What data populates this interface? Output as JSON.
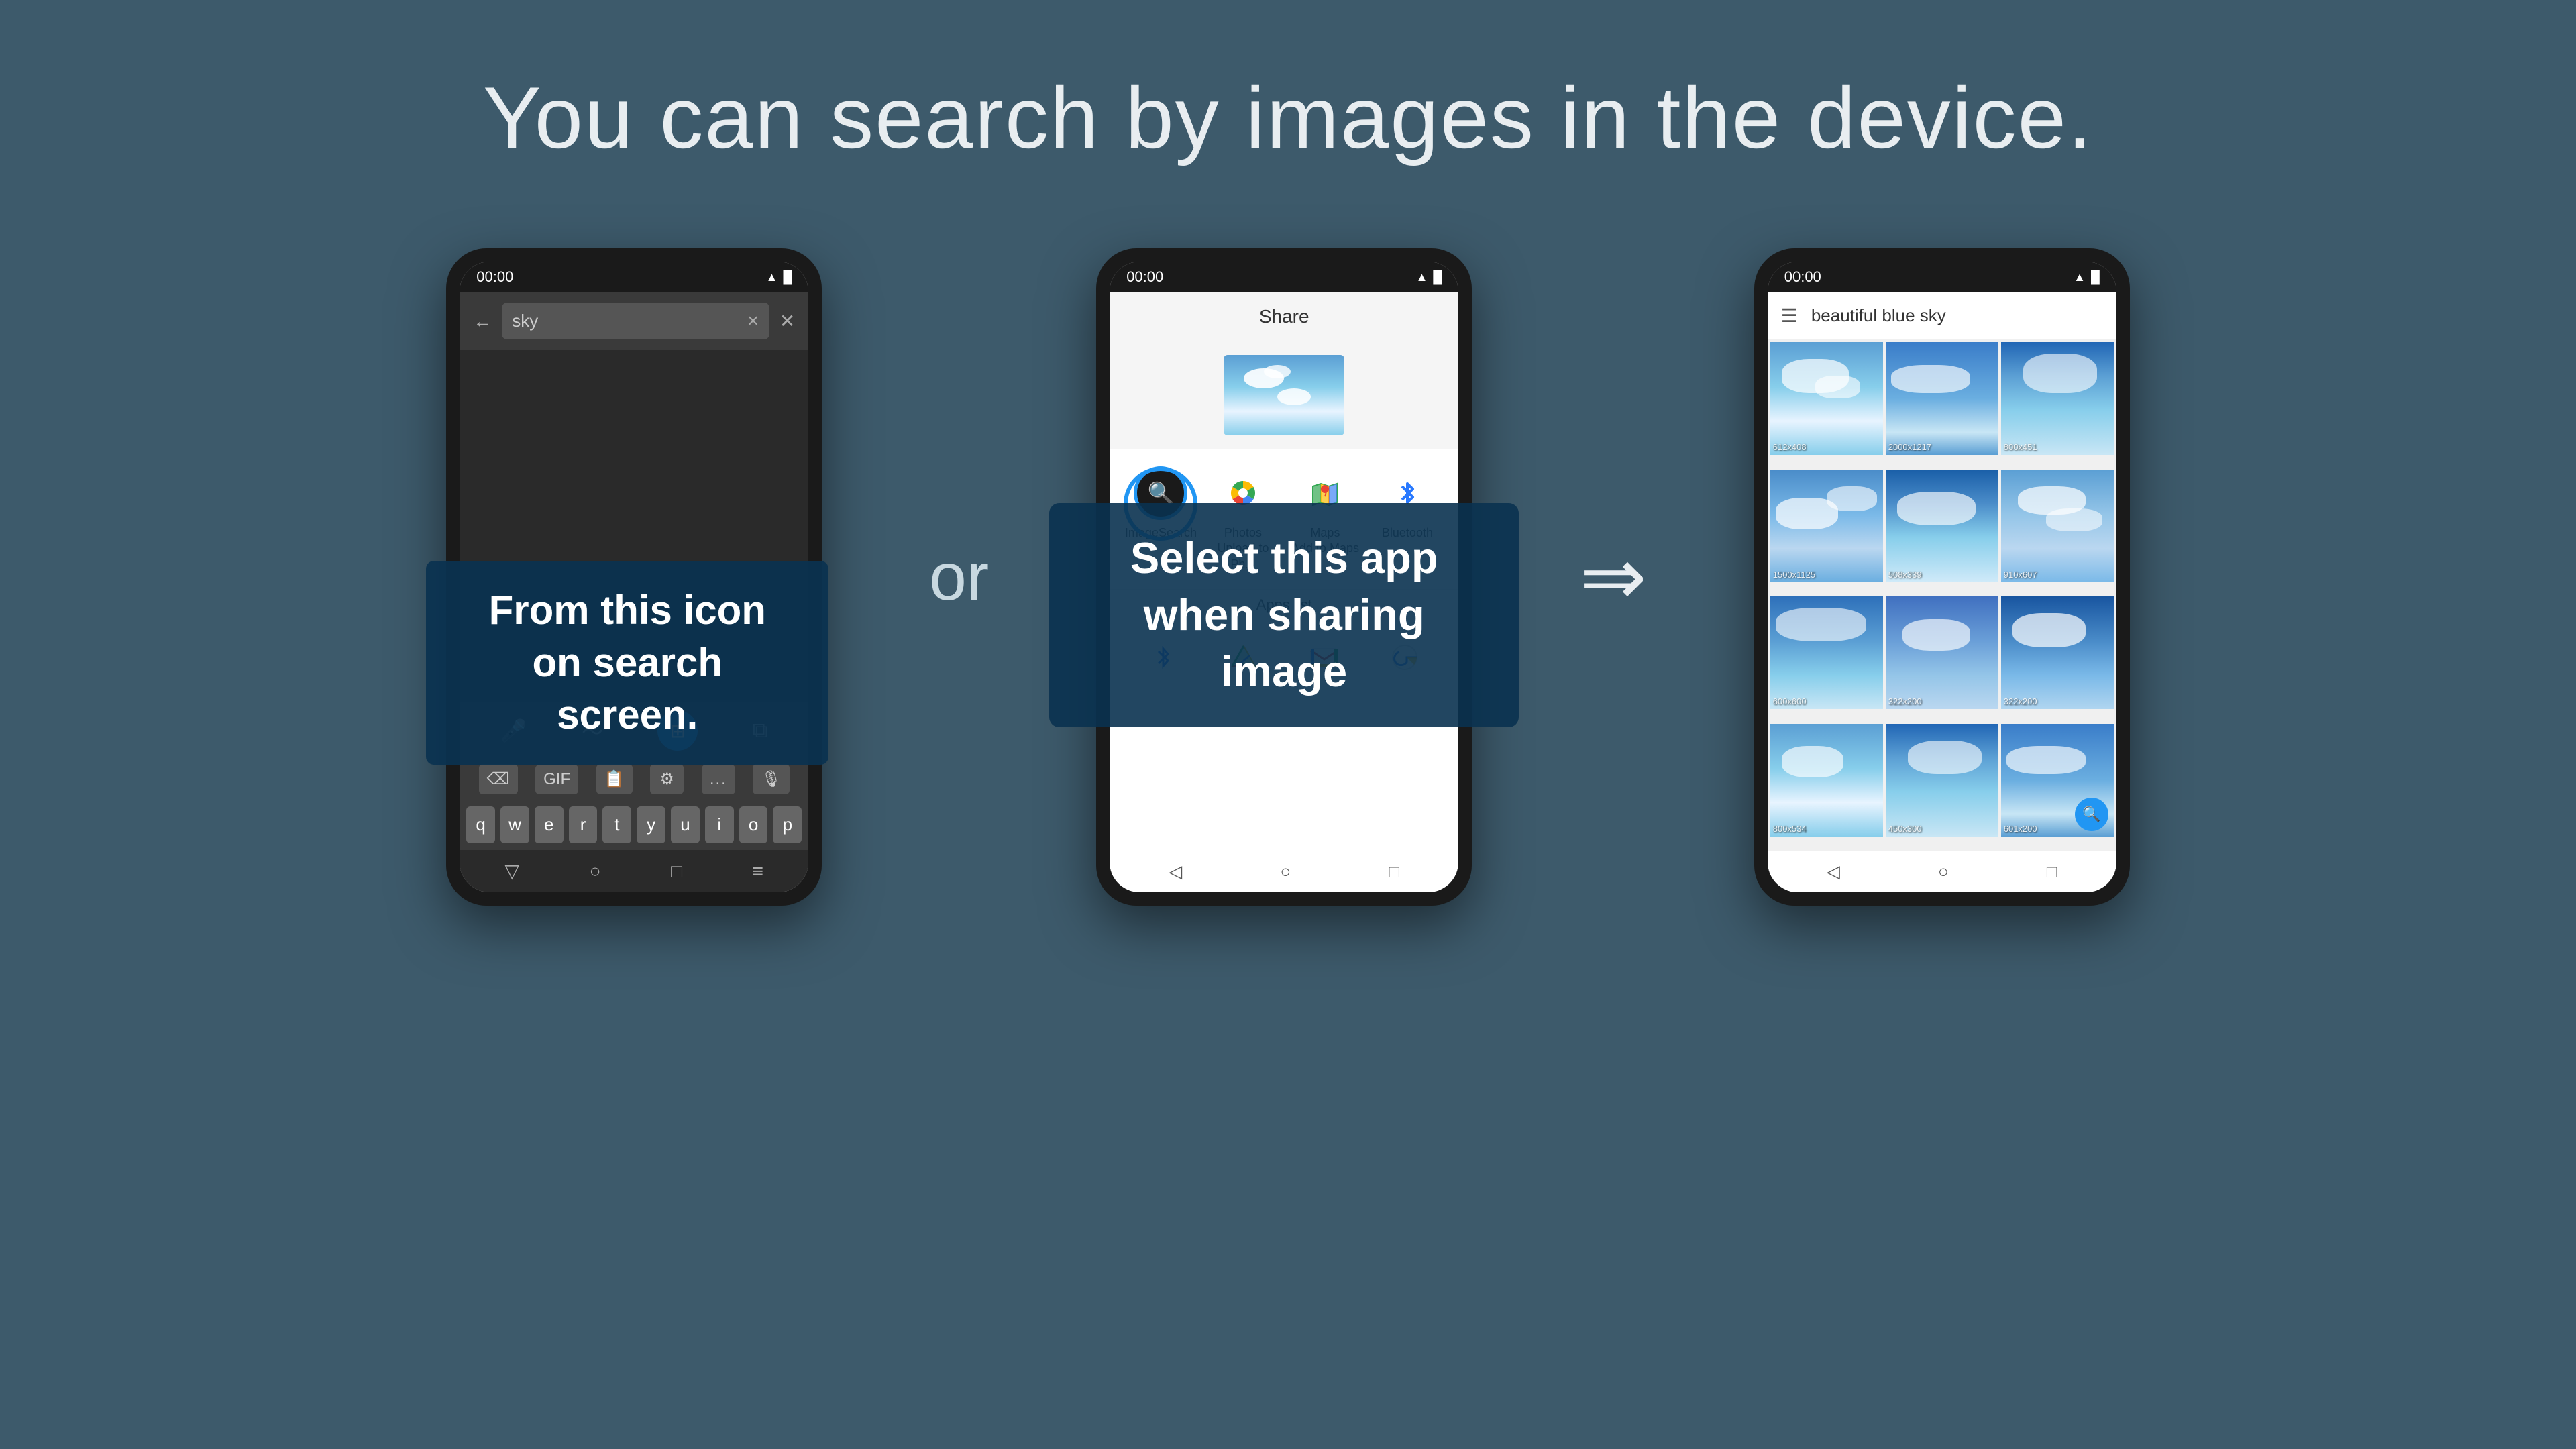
{
  "page": {
    "title": "You can search by images in the device.",
    "background_color": "#3d5a6b"
  },
  "connector": {
    "or_text": "or",
    "arrow_text": "⇒"
  },
  "tooltip_1": {
    "line1": "From this icon",
    "line2": "on search screen."
  },
  "tooltip_2": {
    "line1": "Select this app",
    "line2": "when sharing image"
  },
  "phone1": {
    "status_time": "00:00",
    "search_placeholder": "sky",
    "keyboard_keys": [
      "q",
      "w",
      "e",
      "r",
      "t",
      "y",
      "u",
      "i",
      "o",
      "p"
    ]
  },
  "phone2": {
    "status_time": "00:00",
    "share_title": "Share",
    "apps": [
      {
        "name": "ImageSearch",
        "label": "ImageSearch"
      },
      {
        "name": "Photos",
        "label": "Photos\nUpload to Ph..."
      },
      {
        "name": "Maps",
        "label": "Maps\nAdd to Maps"
      },
      {
        "name": "Bluetooth",
        "label": "Bluetooth"
      }
    ],
    "apps_list_label": "Apps list",
    "bottom_apps": [
      "bluetooth_small",
      "drive",
      "gmail",
      "google"
    ]
  },
  "phone3": {
    "status_time": "00:00",
    "search_query": "beautiful blue sky",
    "thumbnails": [
      {
        "size": "612x408"
      },
      {
        "size": "2000x1217"
      },
      {
        "size": "800x451"
      },
      {
        "size": "1500x1125"
      },
      {
        "size": "508x339"
      },
      {
        "size": "910x607"
      },
      {
        "size": "600x600"
      },
      {
        "size": "322x200"
      },
      {
        "size": "322x200"
      },
      {
        "size": "800x534"
      },
      {
        "size": "450x300"
      },
      {
        "size": "601x200"
      }
    ]
  }
}
